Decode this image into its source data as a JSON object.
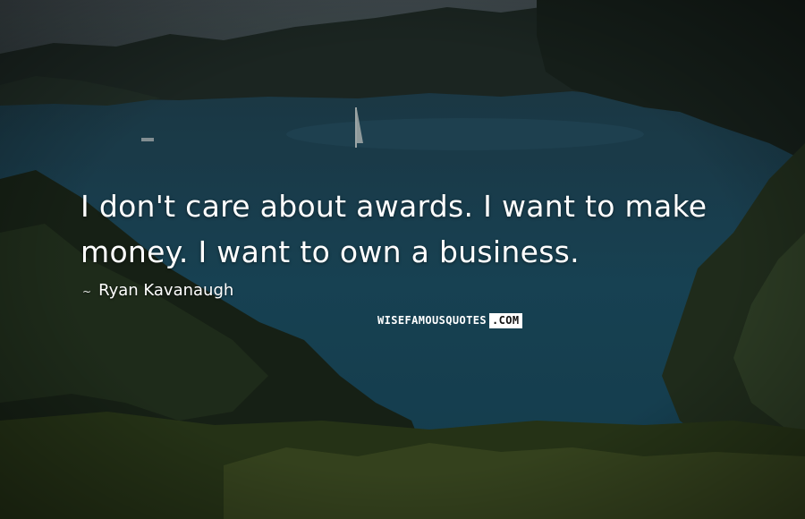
{
  "quote": {
    "text": "I don't care about awards. I want to make money. I want to own a business.",
    "author_prefix": "~",
    "author": "Ryan Kavanaugh"
  },
  "watermark": {
    "brand_main": "WISEFAMOUSQUOTES",
    "brand_tld": ".COM"
  },
  "colors": {
    "text": "#ffffff",
    "water": "#1a4a5e",
    "hills": "#1c2a24",
    "foliage": "#2d3a1c"
  }
}
